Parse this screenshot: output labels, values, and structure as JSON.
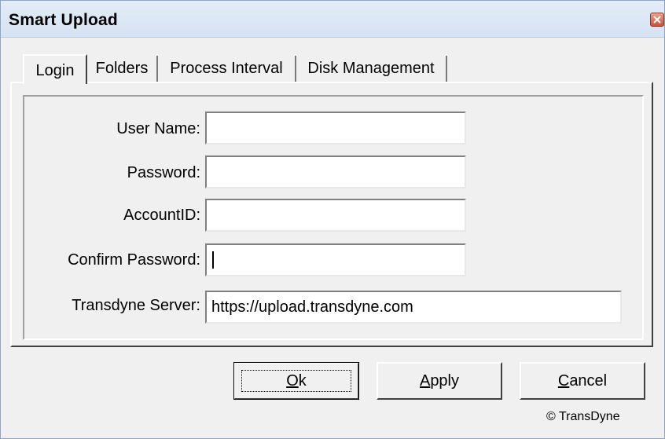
{
  "window": {
    "title": "Smart Upload"
  },
  "tabs": [
    {
      "label": "Login"
    },
    {
      "label": "Folders"
    },
    {
      "label": "Process Interval"
    },
    {
      "label": "Disk Management"
    }
  ],
  "form": {
    "user_name": {
      "label": "User Name:",
      "value": ""
    },
    "password": {
      "label": "Password:",
      "value": ""
    },
    "account_id": {
      "label": "AccountID:",
      "value": ""
    },
    "confirm_password": {
      "label": "Confirm Password:",
      "value": ""
    },
    "server": {
      "label": "Transdyne Server:",
      "value": "https://upload.transdyne.com"
    }
  },
  "buttons": {
    "ok": {
      "mnemonic": "O",
      "rest": "k"
    },
    "apply": {
      "mnemonic": "A",
      "rest": "pply"
    },
    "cancel": {
      "mnemonic": "C",
      "rest": "ancel"
    }
  },
  "footer": {
    "copyright": "© TransDyne"
  },
  "colors": {
    "dialog_bg": "#f0f0f0",
    "titlebar": "#dce7f4",
    "close_button": "#c8523b"
  },
  "icons": {
    "close": "close-icon"
  }
}
